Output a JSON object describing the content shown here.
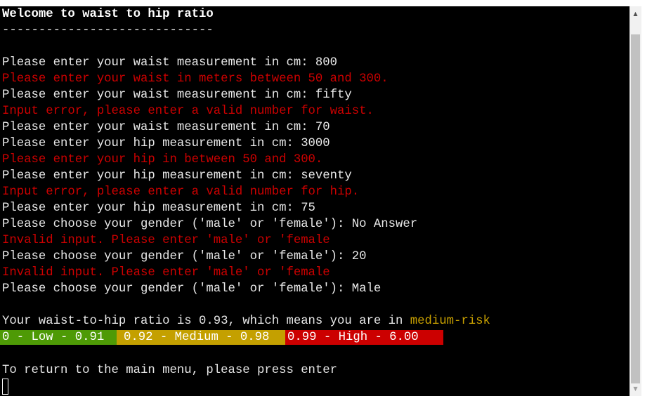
{
  "terminal": {
    "title": "Welcome to waist to hip ratio",
    "divider": "-----------------------------",
    "lines": [
      {
        "text": "Please enter your waist measurement in cm: 800",
        "color": "white"
      },
      {
        "text": "Please enter your waist in meters between 50 and 300.",
        "color": "red"
      },
      {
        "text": "Please enter your waist measurement in cm: fifty",
        "color": "white"
      },
      {
        "text": "Input error, please enter a valid number for waist.",
        "color": "red"
      },
      {
        "text": "Please enter your waist measurement in cm: 70",
        "color": "white"
      },
      {
        "text": "Please enter your hip measurement in cm: 3000",
        "color": "white"
      },
      {
        "text": "Please enter your hip in between 50 and 300.",
        "color": "red"
      },
      {
        "text": "Please enter your hip measurement in cm: seventy",
        "color": "white"
      },
      {
        "text": "Input error, please enter a valid number for hip.",
        "color": "red"
      },
      {
        "text": "Please enter your hip measurement in cm: 75",
        "color": "white"
      },
      {
        "text": "Please choose your gender ('male' or 'female'): No Answer",
        "color": "white"
      },
      {
        "text": "Invalid input. Please enter 'male' or 'female",
        "color": "red"
      },
      {
        "text": "Please choose your gender ('male' or 'female'): 20",
        "color": "white"
      },
      {
        "text": "Invalid input. Please enter 'male' or 'female",
        "color": "red"
      },
      {
        "text": "Please choose your gender ('male' or 'female'): Male",
        "color": "white"
      }
    ],
    "result": {
      "prefix": "Your waist-to-hip ratio is 0.93, which means you are in ",
      "risk": "medium-risk"
    },
    "bands": [
      {
        "label": "0 - Low - 0.91",
        "color": "#4e9a06"
      },
      {
        "label": "0.92 - Medium - 0.98",
        "color": "#c4a000"
      },
      {
        "label": "0.99 - High - 6.00",
        "color": "#cc0000"
      }
    ],
    "return_prompt": "To return to the main menu, please press enter"
  },
  "colors": {
    "background": "#000000",
    "text": "#e8e8e8",
    "error": "#cc0000",
    "warning": "#c8a000"
  }
}
